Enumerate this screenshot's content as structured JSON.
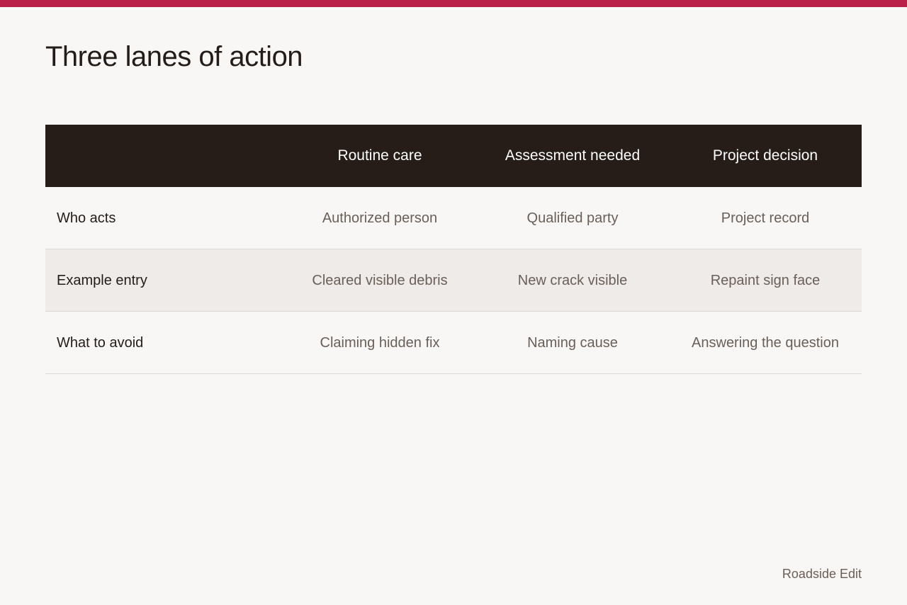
{
  "page": {
    "title": "Three lanes of action",
    "footer": "Roadside Edit"
  },
  "colors": {
    "accent": "#b91f48",
    "header_bg": "#261c18",
    "alt_row_bg": "#efebe8"
  },
  "table": {
    "columns": [
      "",
      "Routine care",
      "Assessment needed",
      "Project decision"
    ],
    "rows": [
      {
        "label": "Who acts",
        "cells": [
          "Authorized person",
          "Qualified party",
          "Project record"
        ]
      },
      {
        "label": "Example entry",
        "cells": [
          "Cleared visible debris",
          "New crack visible",
          "Repaint sign face"
        ]
      },
      {
        "label": "What to avoid",
        "cells": [
          "Claiming hidden fix",
          "Naming cause",
          "Answering the question"
        ]
      }
    ]
  }
}
